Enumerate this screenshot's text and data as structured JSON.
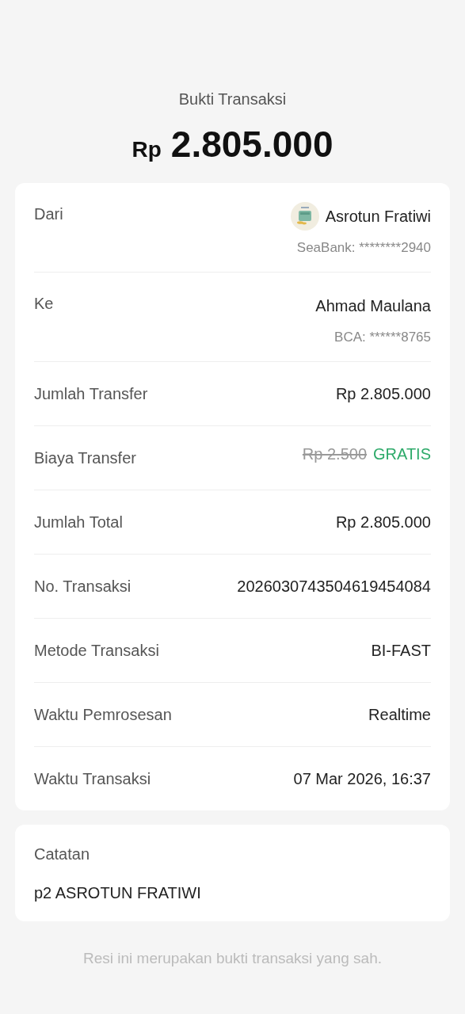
{
  "title": "Bukti Transaksi",
  "amount": {
    "currency": "Rp",
    "value": "2.805.000"
  },
  "rows": [
    {
      "kind": "party",
      "label": "Dari",
      "name": "Asrotun Fratiwi",
      "account": "SeaBank: ********2940",
      "avatar": true
    },
    {
      "kind": "party",
      "label": "Ke",
      "name": "Ahmad Maulana",
      "account": "BCA: ******8765",
      "avatar": false
    },
    {
      "kind": "plain",
      "label": "Jumlah Transfer",
      "value": "Rp 2.805.000"
    },
    {
      "kind": "fee",
      "label": "Biaya Transfer",
      "original": "Rp 2.500",
      "value": "GRATIS"
    },
    {
      "kind": "plain",
      "label": "Jumlah Total",
      "value": "Rp 2.805.000"
    },
    {
      "kind": "plain",
      "label": "No. Transaksi",
      "value": "2026030743504619454084"
    },
    {
      "kind": "plain",
      "label": "Metode Transaksi",
      "value": "BI-FAST"
    },
    {
      "kind": "plain",
      "label": "Waktu Pemrosesan",
      "value": "Realtime"
    },
    {
      "kind": "plain",
      "label": "Waktu Transaksi",
      "value": "07 Mar 2026, 16:37"
    }
  ],
  "note": {
    "label": "Catatan",
    "text": "p2 ASROTUN FRATIWI"
  },
  "footer": "Resi ini merupakan bukti transaksi yang sah."
}
